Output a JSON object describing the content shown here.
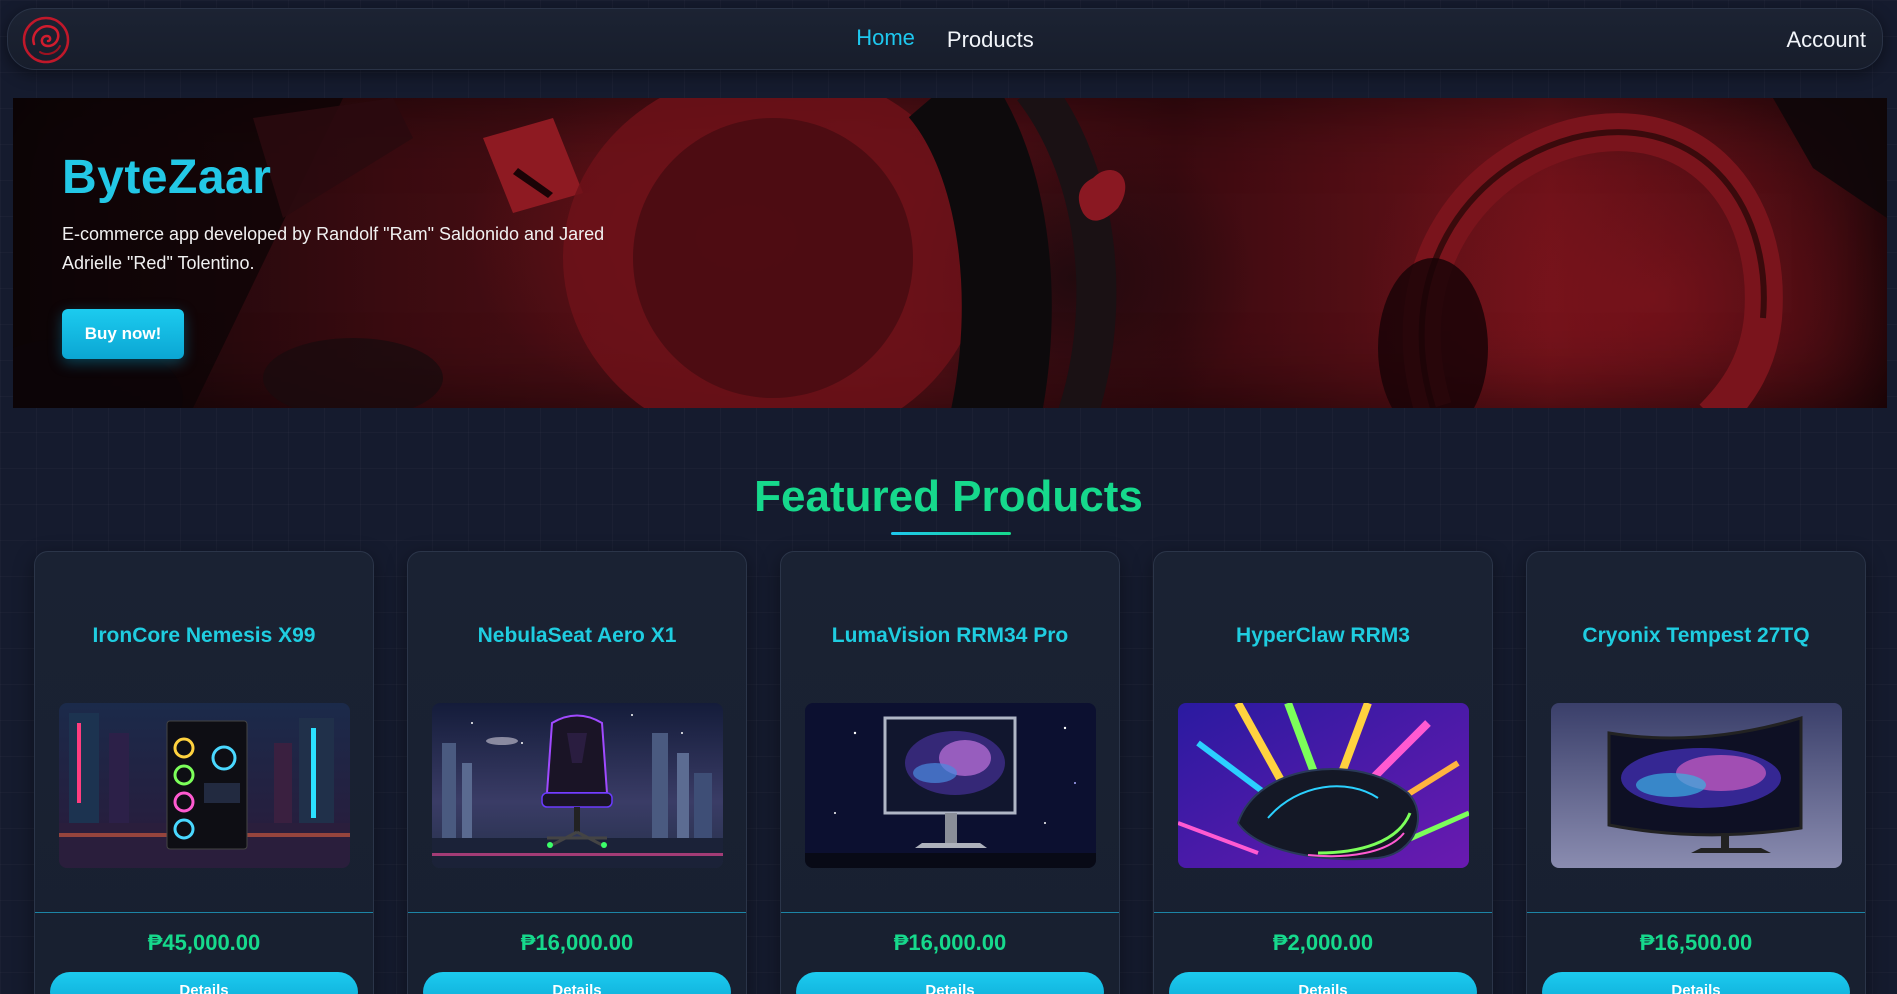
{
  "nav": {
    "logo": "swirl-logo-icon",
    "links": [
      {
        "label": "Home",
        "active": true
      },
      {
        "label": "Products",
        "active": false
      }
    ],
    "account_label": "Account"
  },
  "hero": {
    "title": "ByteZaar",
    "description": "E-commerce app developed by Randolf \"Ram\" Saldonido and Jared Adrielle \"Red\" Tolentino.",
    "button_label": "Buy now!"
  },
  "featured": {
    "title": "Featured Products",
    "products": [
      {
        "name": "IronCore Nemesis X99",
        "price": "₱45,000.00",
        "button_label": "Details",
        "image": "gaming-pc-case-image"
      },
      {
        "name": "NebulaSeat Aero X1",
        "price": "₱16,000.00",
        "button_label": "Details",
        "image": "gaming-chair-image"
      },
      {
        "name": "LumaVision RRM34 Pro",
        "price": "₱16,000.00",
        "button_label": "Details",
        "image": "monitor-image"
      },
      {
        "name": "HyperClaw RRM3",
        "price": "₱2,000.00",
        "button_label": "Details",
        "image": "gaming-mouse-image"
      },
      {
        "name": "Cryonix Tempest 27TQ",
        "price": "₱16,500.00",
        "button_label": "Details",
        "image": "curved-monitor-image"
      }
    ]
  },
  "colors": {
    "accent": "#1ec8ef",
    "price": "#16d98c",
    "background": "#151b2e"
  }
}
